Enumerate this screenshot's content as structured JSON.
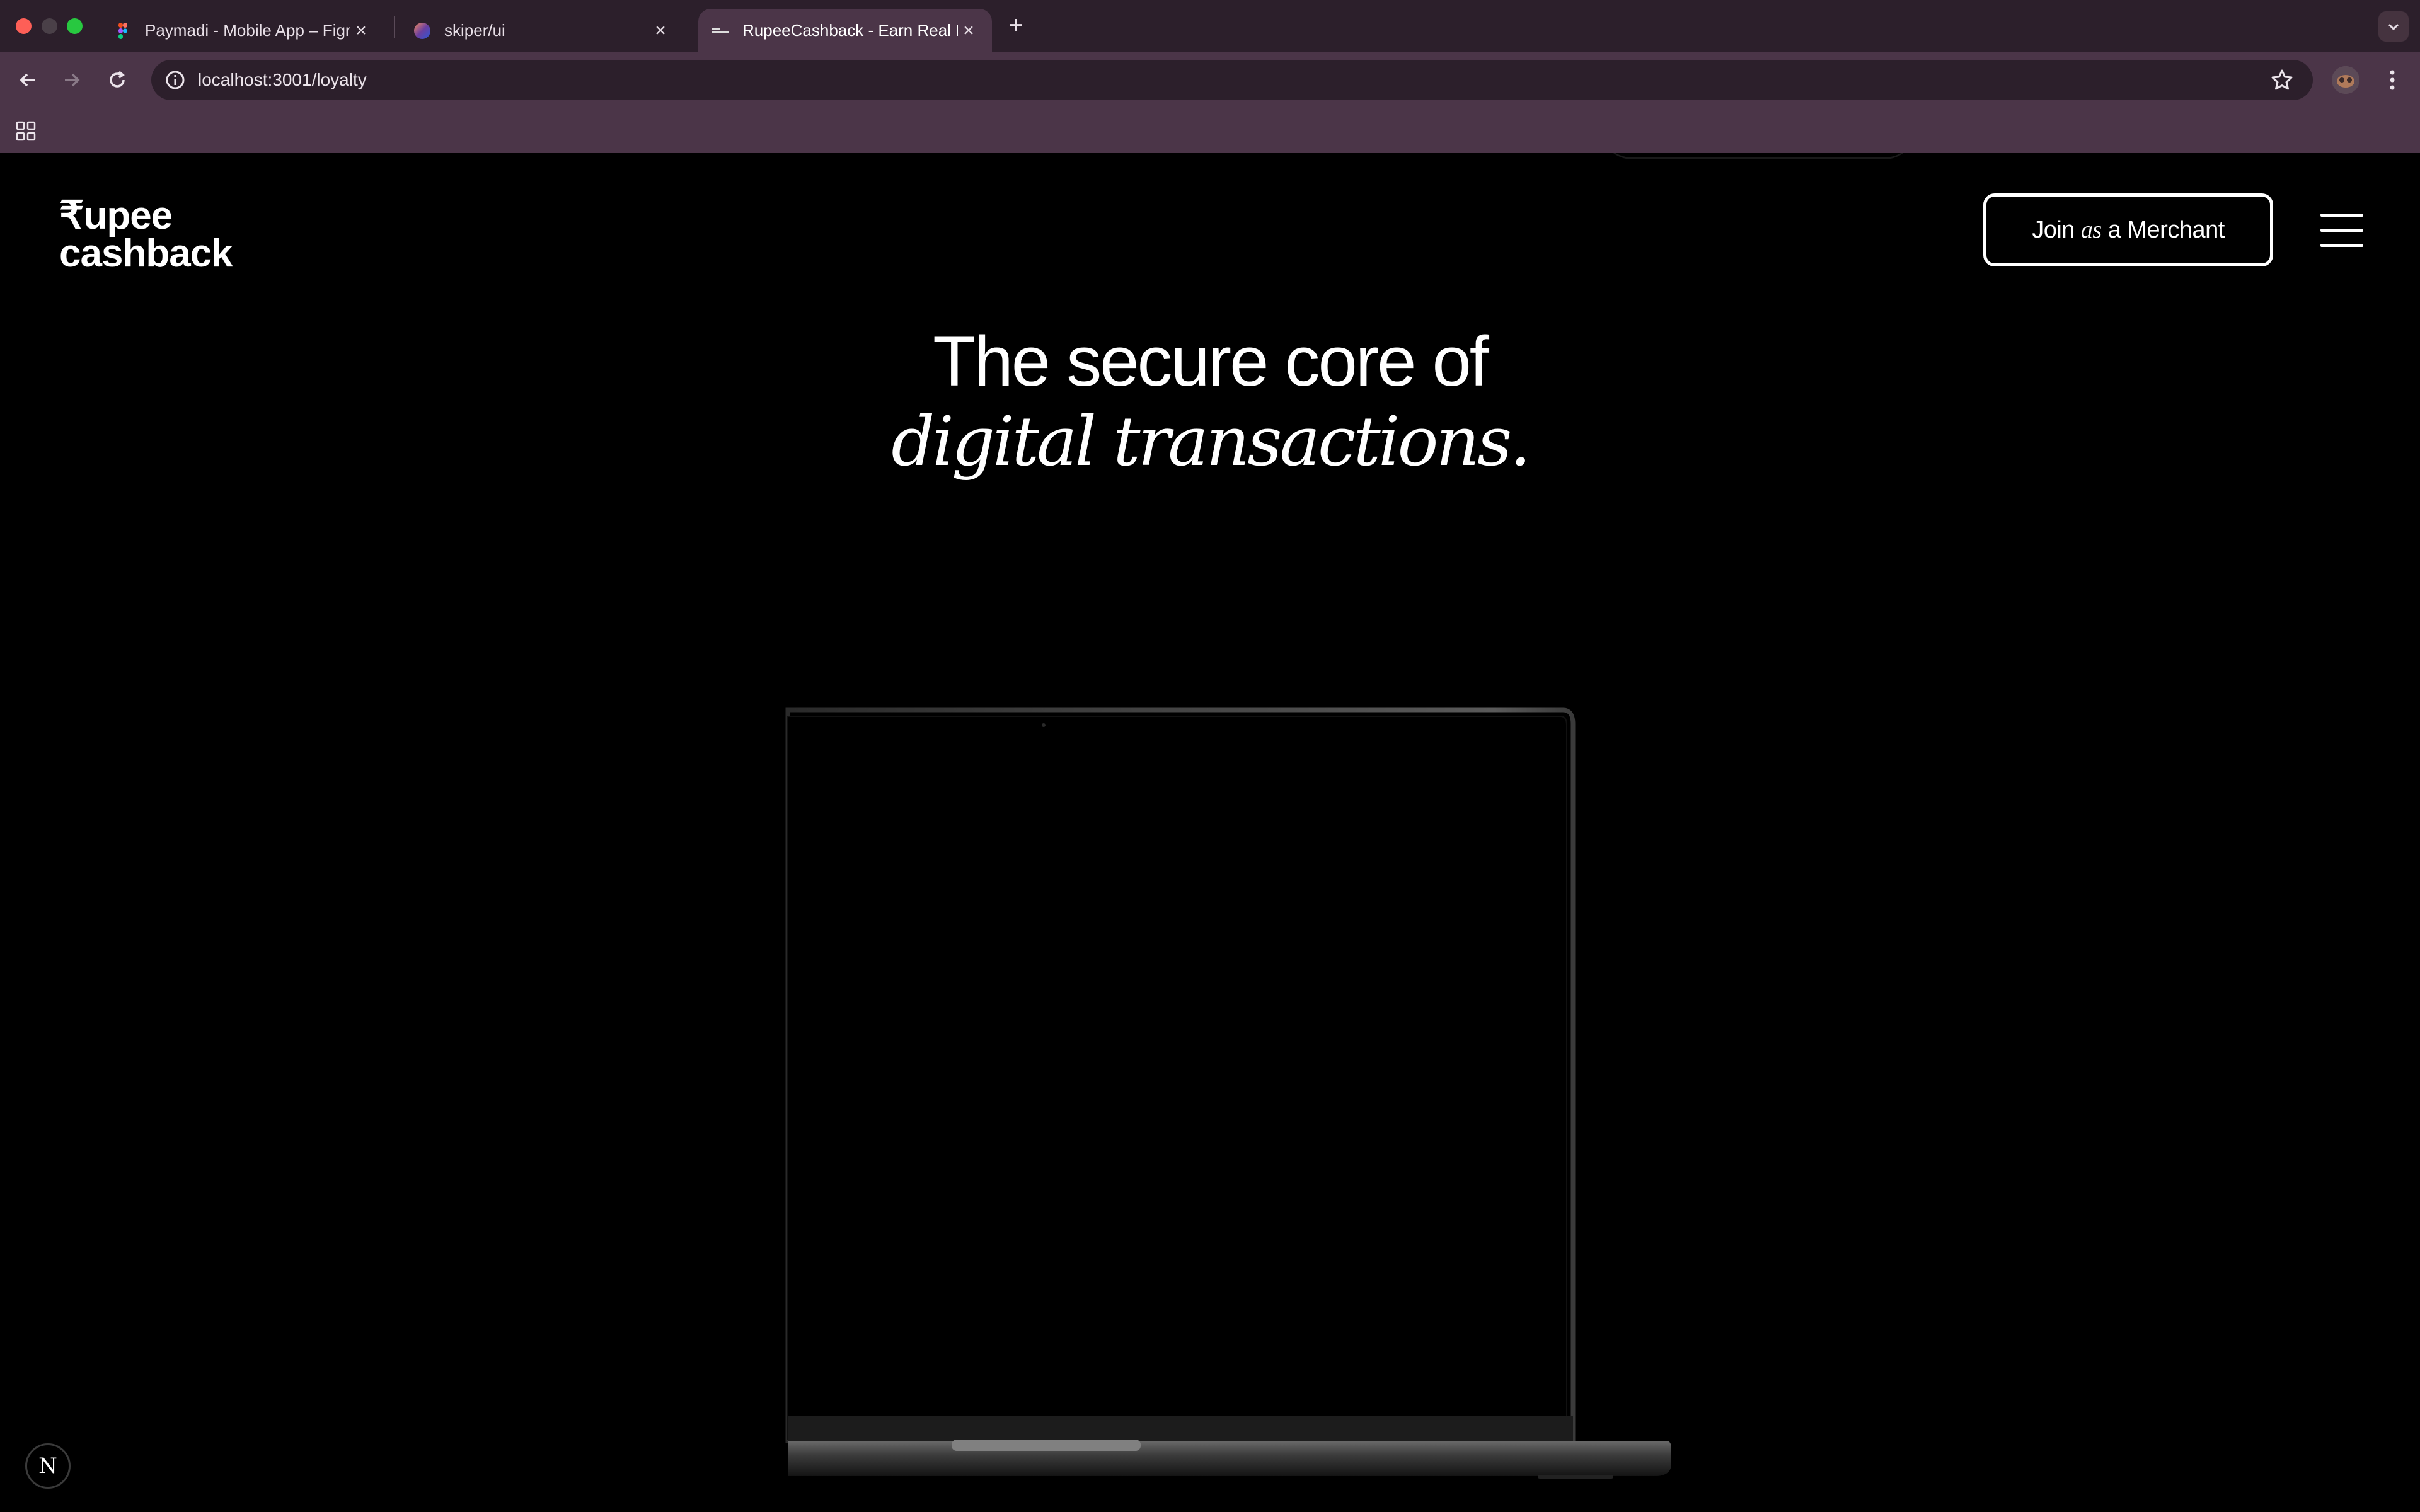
{
  "browser": {
    "tabs": [
      {
        "title": "Paymadi - Mobile App – Figma",
        "favicon": "figma-icon",
        "active": false
      },
      {
        "title": "skiper/ui",
        "favicon": "skiper-icon",
        "active": false
      },
      {
        "title": "RupeeCashback - Earn Real Money",
        "favicon": "rupeecashback-icon",
        "active": true
      }
    ],
    "url": "localhost:3001/loyalty",
    "colors": {
      "tabstrip": "#2c1f2b",
      "toolbar": "#4b3548"
    }
  },
  "page": {
    "logo": {
      "line1": "₹upee",
      "line2": "cashback"
    },
    "header": {
      "merchant_button": {
        "pre": "Join",
        "italic": "as",
        "post": "a Merchant"
      },
      "menu_icon": "hamburger-icon"
    },
    "hero": {
      "line1": "The secure core of",
      "line2": "digital transactions."
    },
    "badge": "N",
    "colors": {
      "background": "#000000",
      "text": "#ffffff"
    }
  }
}
